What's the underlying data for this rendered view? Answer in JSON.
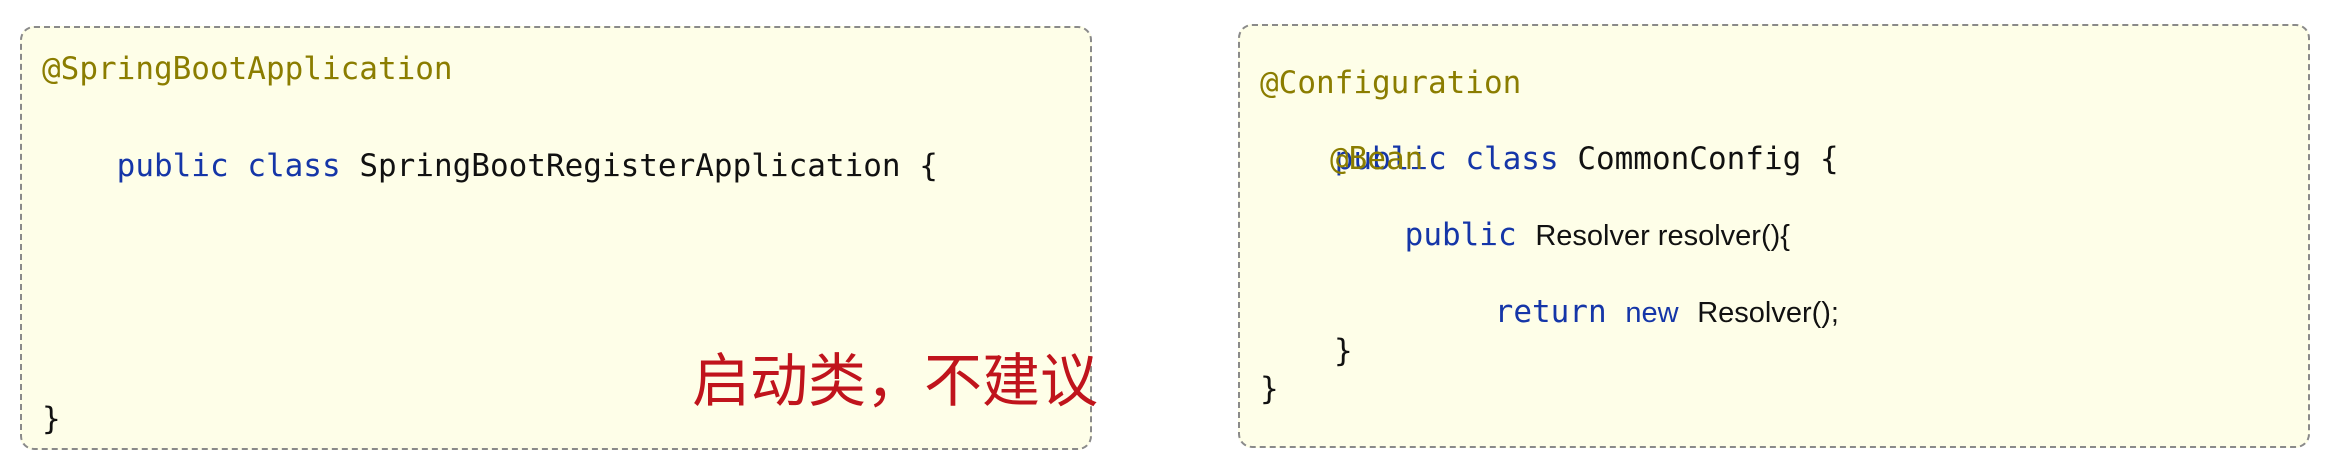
{
  "left_panel": {
    "annotation": "@SpringBootApplication",
    "class_decl": {
      "kw_public": "public",
      "kw_class": "class",
      "name": "SpringBootRegisterApplication",
      "open_brace": "{"
    },
    "close_brace": "}",
    "note": "启动类，不建议"
  },
  "right_panel": {
    "annotation": "@Configuration",
    "class_decl": {
      "kw_public": "public",
      "kw_class": "class",
      "name": "CommonConfig",
      "open_brace": "{"
    },
    "bean_annotation": "@Bean",
    "method_decl": {
      "kw_public": "public",
      "rest": "Resolver resolver(){"
    },
    "return_stmt": {
      "kw_return": "return",
      "kw_new": "new",
      "rest": "Resolver();"
    },
    "method_close": "}",
    "class_close": "}"
  },
  "colors": {
    "annotation": "#8b7d00",
    "keyword": "#1536a8",
    "note": "#c0141c",
    "panel_bg": "#fefee8"
  }
}
